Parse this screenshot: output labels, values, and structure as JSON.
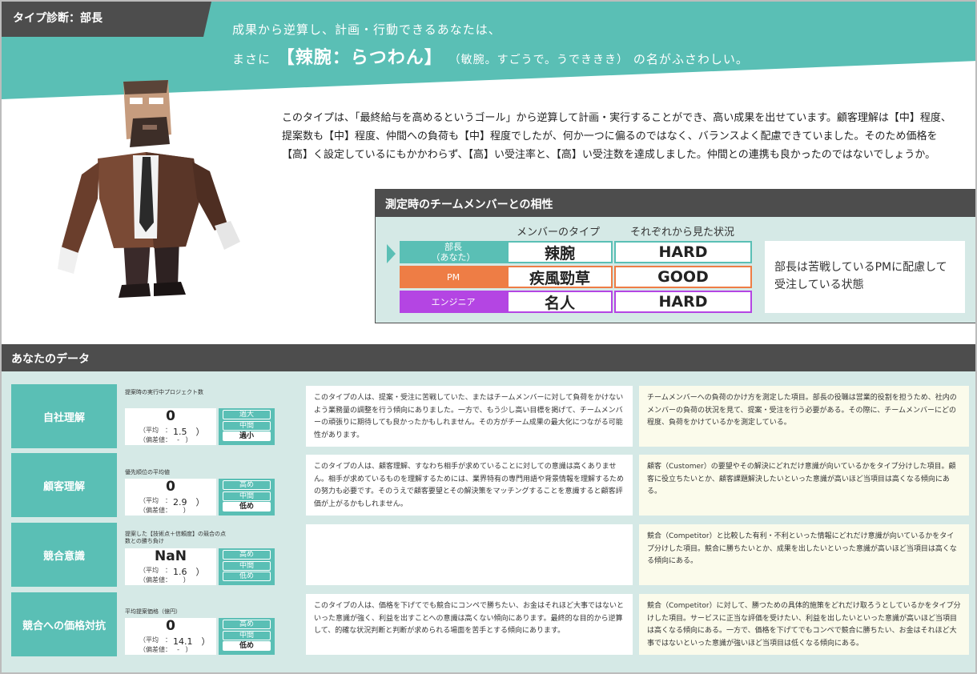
{
  "header": {
    "type_tag": "タイプ診断：部長",
    "lead_line1": "成果から逆算し、計画・行動できるあなたは、",
    "lead_prefix": "まさに",
    "lead_highlight": "【辣腕：らつわん】",
    "lead_paren": "（敏腕。すごうで。うでききき）",
    "lead_suffix": "の名がふさわしい。"
  },
  "description": "このタイプは、「最終給与を高めるというゴール」から逆算して計画・実行することができ、高い成果を出せています。顧客理解は【中】程度、提案数も【中】程度、仲間への負荷も【中】程度でしたが、何か一つに偏るのではなく、バランスよく配慮できていました。そのため価格を【高】く設定しているにもかかわらず、【高】い受注率と、【高】い受注数を達成しました。仲間との連携も良かったのではないでしょうか。",
  "compat": {
    "title": "測定時のチームメンバーとの相性",
    "col_type": "メンバーのタイプ",
    "col_status": "それぞれから見た状況",
    "rows": [
      {
        "role_line1": "部長",
        "role_line2": "（あなた）",
        "type": "辣腕",
        "status": "HARD",
        "color": "#5abfb5"
      },
      {
        "role_line1": "PM",
        "role_line2": "",
        "type": "疾風勁草",
        "status": "GOOD",
        "color": "#ee7d45"
      },
      {
        "role_line1": "エンジニア",
        "role_line2": "",
        "type": "名人",
        "status": "HARD",
        "color": "#b445e3"
      }
    ],
    "note": "部長は苦戦しているPMに配慮して受注している状態"
  },
  "data_section": {
    "title": "あなたのデータ",
    "mean_label": "（平均　：",
    "dev_label": "（偏差値：",
    "close_paren": "）",
    "rows": [
      {
        "label": "自社理解",
        "sub": "提案時の実行中プロジェクト数",
        "value": "0",
        "mean": "1.5",
        "deviation": "-",
        "levels": [
          "過大",
          "中間",
          "過小"
        ],
        "selected": 2,
        "comment": "このタイプの人は、提案・受注に苦戦していた、またはチームメンバーに対して負荷をかけないよう業務量の調整を行う傾向にありました。一方で、もう少し高い目標を掲げて、チームメンバーの頑張りに期待しても良かったかもしれません。その方がチーム成果の最大化につながる可能性があります。",
        "explanation": "チームメンバーへの負荷のかけ方を測定した項目。部長の役職は営業的役割を担うため、社内のメンバーの負荷の状況を見て、提案・受注を行う必要がある。その際に、チームメンバーにどの程度、負荷をかけているかを測定している。"
      },
      {
        "label": "顧客理解",
        "sub": "優先順位の平均値",
        "value": "0",
        "mean": "2.9",
        "deviation": "",
        "levels": [
          "高め",
          "中間",
          "低め"
        ],
        "selected": 2,
        "comment": "このタイプの人は、顧客理解、すなわち相手が求めていることに対しての意識は高くありません。相手が求めているものを理解するためには、業界特有の専門用語や背景情報を理解するための努力も必要です。そのうえで顧客要望とその解決策をマッチングすることを意識すると顧客評価が上がるかもしれません。",
        "explanation": "顧客（Customer）の要望やその解決にどれだけ意識が向いているかをタイプ分けした項目。顧客に役立ちたいとか、顧客課題解決したいといった意識が高いほど当項目は高くなる傾向にある。"
      },
      {
        "label": "競合意識",
        "sub": "提案した【技術点＋信頼度】の競合の点数との勝ち負け",
        "value": "NaN",
        "mean": "1.6",
        "deviation": "",
        "levels": [
          "高め",
          "中間",
          "低め"
        ],
        "selected": -1,
        "comment": "",
        "explanation": "競合（Competitor）と比較した有利・不利といった情報にどれだけ意識が向いているかをタイプ分けした項目。競合に勝ちたいとか、成果を出したいといった意識が高いほど当項目は高くなる傾向にある。"
      },
      {
        "label": "競合への価格対抗",
        "sub": "平均提案価格（億円）",
        "value": "0",
        "mean": "14.1",
        "deviation": "-",
        "levels": [
          "高め",
          "中間",
          "低め"
        ],
        "selected": 2,
        "comment": "このタイプの人は、価格を下げてでも競合にコンペで勝ちたい、お金はそれほど大事ではないといった意識が強く、利益を出すことへの意識は高くない傾向にあります。最終的な目的から逆算して、的確な状況判断と判断が求められる場面を苦手とする傾向にあります。",
        "explanation": "競合（Competitor）に対して、勝つための具体的施策をどれだけ取ろうとしているかをタイプ分けした項目。サービスに正当な評価を受けたい、利益を出したいといった意識が高いほど当項目は高くなる傾向にある。一方で、価格を下げてでもコンペで競合に勝ちたい、お金はそれほど大事ではないといった意識が強いほど当項目は低くなる傾向にある。"
      }
    ]
  },
  "colors": {
    "teal": "#5abfb5",
    "dark": "#4d4d4d",
    "light_teal": "#d5e9e6",
    "orange": "#ee7d45",
    "purple": "#b445e3"
  }
}
